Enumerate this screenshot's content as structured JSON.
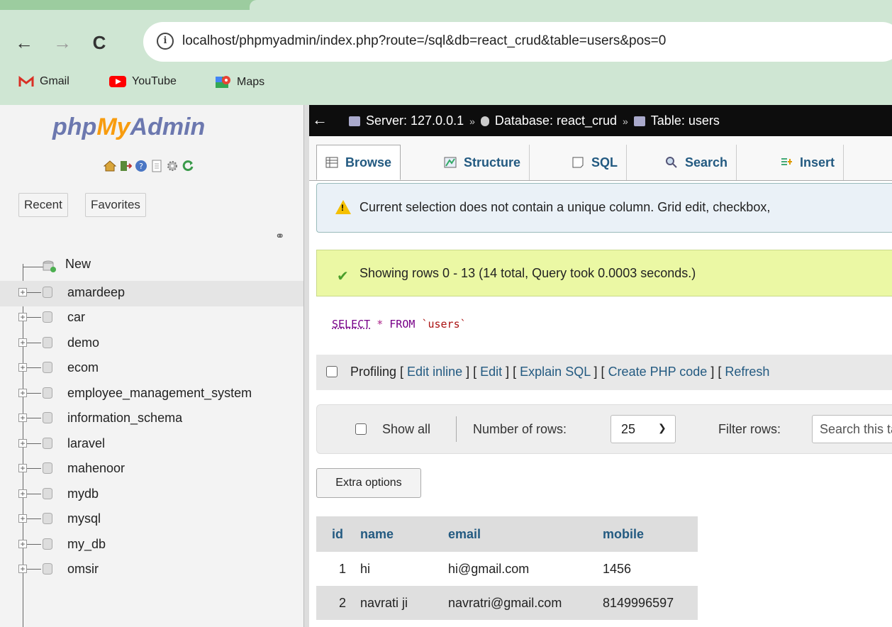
{
  "browser": {
    "url_display": "localhost/phpmyadmin/index.php?route=/sql&db=react_crud&table=users&pos=0",
    "bookmarks": [
      {
        "label": "Gmail",
        "icon": "gmail-icon"
      },
      {
        "label": "YouTube",
        "icon": "youtube-icon"
      },
      {
        "label": "Maps",
        "icon": "maps-icon"
      }
    ]
  },
  "sidebar": {
    "logo_php": "php",
    "logo_my": "My",
    "logo_admin": "Admin",
    "tabs": [
      "Recent",
      "Favorites"
    ],
    "new_label": "New",
    "databases": [
      "amardeep",
      "car",
      "demo",
      "ecom",
      "employee_management_system",
      "information_schema",
      "laravel",
      "mahenoor",
      "mydb",
      "mysql",
      "my_db",
      "omsir"
    ]
  },
  "breadcrumb": {
    "server": "Server: 127.0.0.1",
    "database": "Database: react_crud",
    "table": "Table: users"
  },
  "tabs": [
    "Browse",
    "Structure",
    "SQL",
    "Search",
    "Insert"
  ],
  "messages": {
    "warning": "Current selection does not contain a unique column. Grid edit, checkbox,",
    "success": "Showing rows 0 - 13 (14 total, Query took 0.0003 seconds.)"
  },
  "sql": {
    "select": "SELECT",
    "star": "*",
    "from": "FROM",
    "table": "`users`"
  },
  "profiling": {
    "label": "Profiling",
    "links": [
      "Edit inline",
      "Edit",
      "Explain SQL",
      "Create PHP code",
      "Refresh"
    ]
  },
  "navigation": {
    "show_all": "Show all",
    "rows_label": "Number of rows:",
    "rows_value": "25",
    "filter_label": "Filter rows:",
    "filter_placeholder": "Search this table"
  },
  "extra_options": "Extra options",
  "table": {
    "columns": [
      "id",
      "name",
      "email",
      "mobile"
    ],
    "rows": [
      [
        "1",
        "hi",
        "hi@gmail.com",
        "1456"
      ],
      [
        "2",
        "navrati ji",
        "navratri@gmail.com",
        "8149996597"
      ]
    ]
  }
}
